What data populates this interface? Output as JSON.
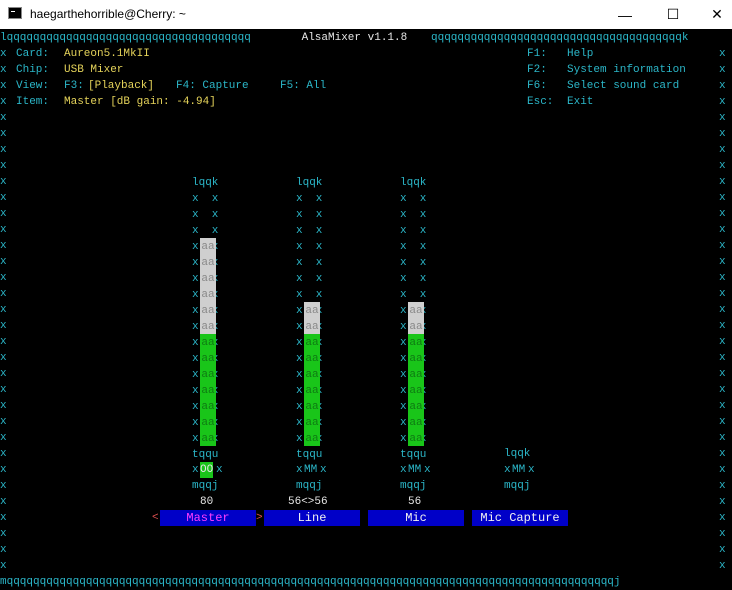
{
  "window": {
    "title": "haegarthehorrible@Cherry: ~",
    "minimize_glyph": "—",
    "maximize_glyph": "☐",
    "close_glyph": "✕"
  },
  "mixer": {
    "title": " AlsaMixer v1.1.8 ",
    "border_top_left": "lqqqqqqqqqqqqqqqqqqqqqqqqqqqqqqqqqqqqq",
    "border_top_right": "qqqqqqqqqqqqqqqqqqqqqqqqqqqqqqqqqqqqqqk",
    "border_bottom": "mqqqqqqqqqqqqqqqqqqqqqqqqqqqqqqqqqqqqqqqqqqqqqqqqqqqqqqqqqqqqqqqqqqqqqqqqqqqqqqqqqqqqqqqqqqqqj",
    "border_side": "x",
    "info": {
      "card_label": "Card:",
      "card_value": "Aureon5.1MkII",
      "chip_label": "Chip:",
      "chip_value": "USB Mixer",
      "view_label": "View:",
      "view_f3": "F3:",
      "view_playback": "[Playback]",
      "view_f4": "F4: Capture",
      "view_f5": "F5: All",
      "item_label": "Item:",
      "item_value": "Master [dB gain: -4.94]"
    },
    "keys": [
      {
        "key": "F1:",
        "desc": "Help"
      },
      {
        "key": "F2:",
        "desc": "System information"
      },
      {
        "key": "F6:",
        "desc": "Select sound card"
      },
      {
        "key": "Esc:",
        "desc": "Exit"
      }
    ],
    "channels": [
      {
        "name": "Master",
        "level": 80,
        "value_text": "80",
        "switch": "OO",
        "selected": true,
        "left_marker": "<",
        "right_marker": ">"
      },
      {
        "name": "Line",
        "level": 56,
        "value_text": "56<>56",
        "switch": "MM",
        "selected": false
      },
      {
        "name": "Mic",
        "level": 56,
        "value_text": "56",
        "switch": "MM",
        "selected": false
      },
      {
        "name": "Mic Capture",
        "switch": "MM",
        "selected": false
      }
    ],
    "glyphs": {
      "bar_top": "lqqk",
      "bar_side_pair": "x  x",
      "bar_sep": "tqqu",
      "bar_bottom": "mqqj",
      "fill": "aa"
    }
  }
}
